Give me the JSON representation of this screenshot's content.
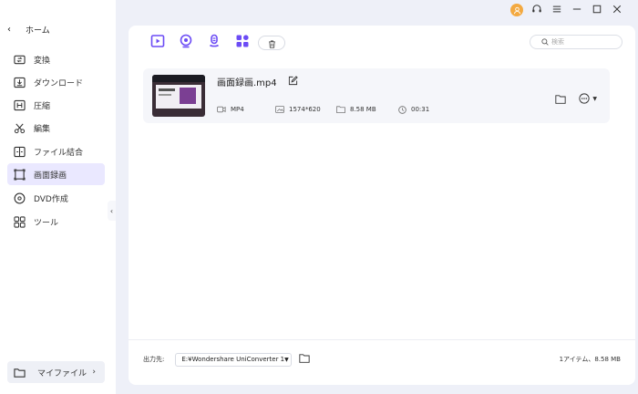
{
  "sidebar": {
    "home_label": "ホーム",
    "items": [
      {
        "label": "変換",
        "icon": "convert-icon"
      },
      {
        "label": "ダウンロード",
        "icon": "download-icon"
      },
      {
        "label": "圧縮",
        "icon": "compress-icon"
      },
      {
        "label": "編集",
        "icon": "scissors-icon"
      },
      {
        "label": "ファイル結合",
        "icon": "merge-icon"
      },
      {
        "label": "画面録画",
        "icon": "screen-record-icon",
        "active": true
      },
      {
        "label": "DVD作成",
        "icon": "dvd-icon"
      },
      {
        "label": "ツール",
        "icon": "tools-icon"
      }
    ],
    "my_files_label": "マイファイル"
  },
  "search": {
    "placeholder": "検索"
  },
  "file": {
    "name": "画面録画.mp4",
    "format": "MP4",
    "resolution": "1574*620",
    "size": "8.58 MB",
    "duration": "00:31"
  },
  "footer": {
    "output_label": "出力先:",
    "output_path": "E:¥Wondershare UniConverter 1",
    "summary": "1アイテム、8.58 MB"
  },
  "colors": {
    "accent": "#6c4cf5",
    "active_bg": "#eae8ff",
    "avatar": "#f3a941"
  }
}
